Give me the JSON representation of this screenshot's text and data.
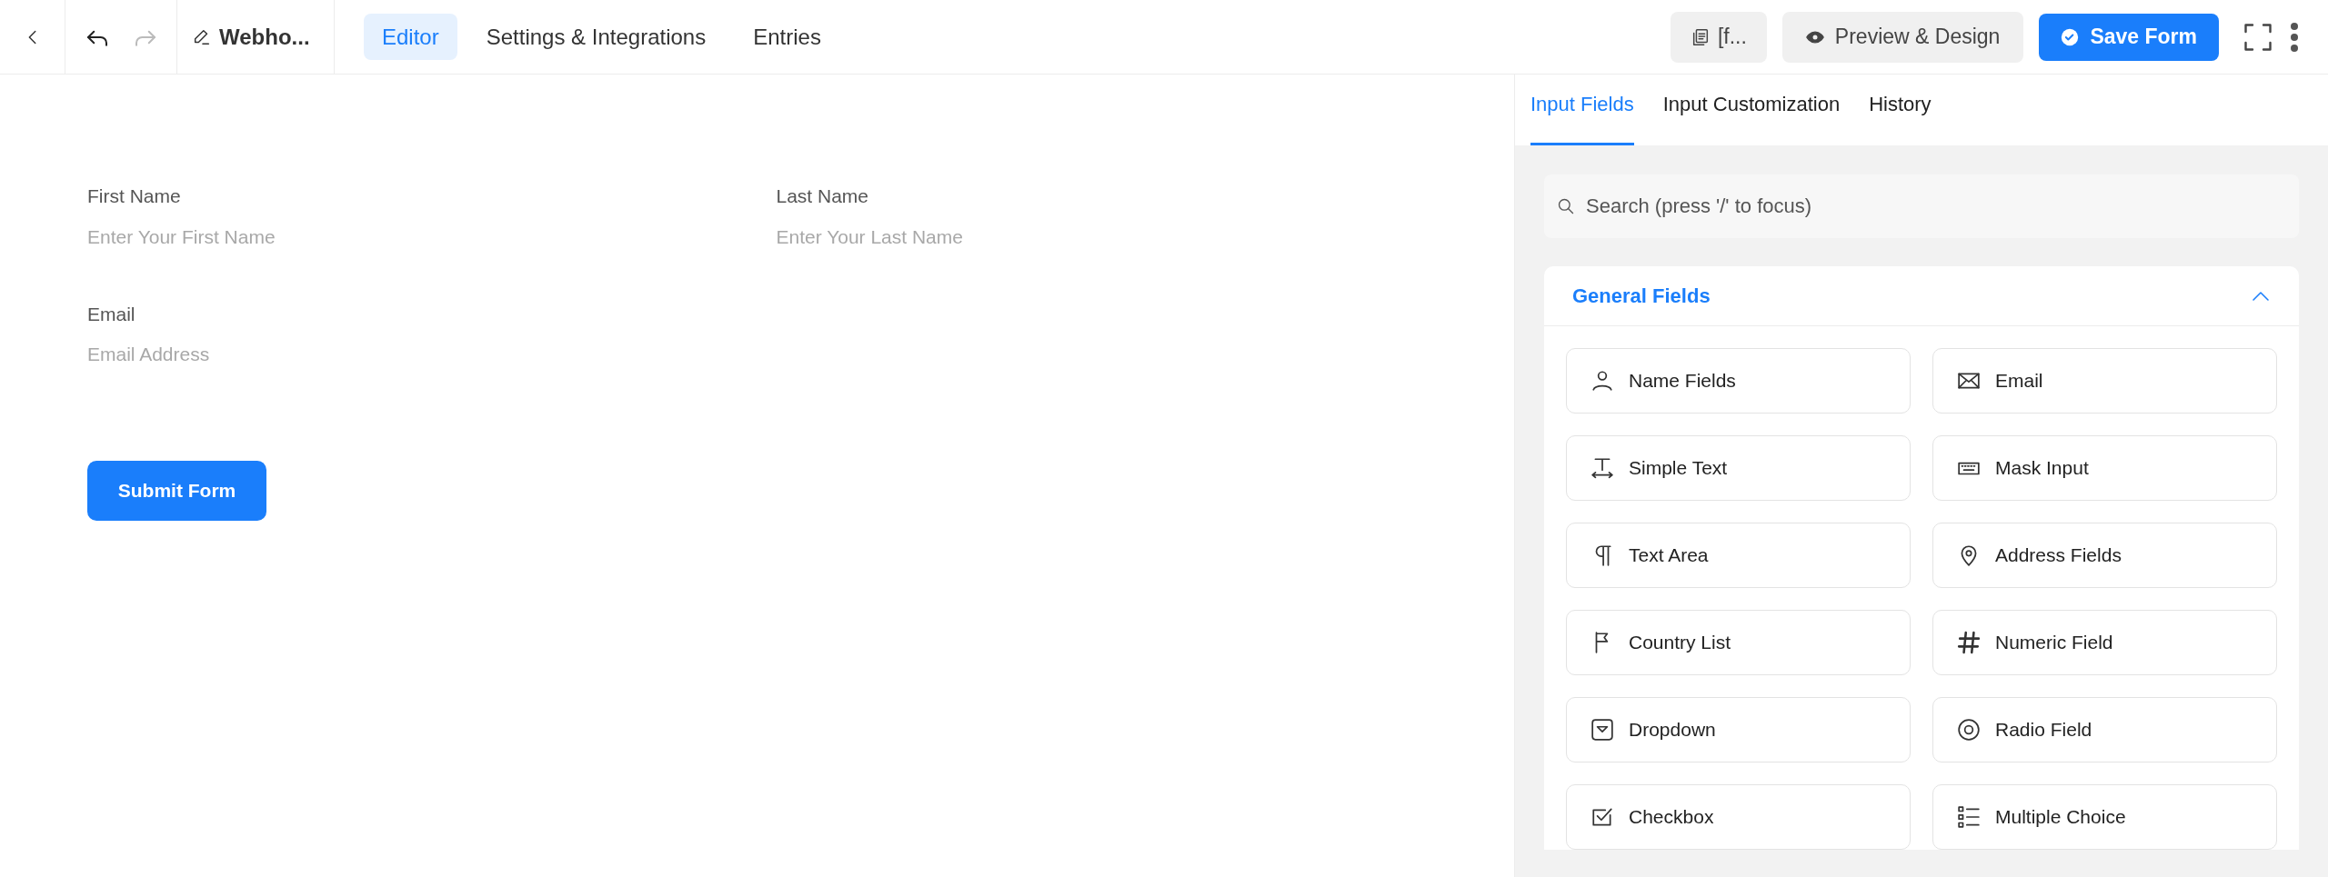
{
  "toolbar": {
    "history": [
      {
        "kind": "undo",
        "disabled": false
      },
      {
        "kind": "redo",
        "disabled": true
      }
    ],
    "title": "Webho...",
    "tabs": [
      {
        "label": "Editor",
        "selected": true
      },
      {
        "label": "Settings & Integrations",
        "selected": false
      },
      {
        "label": "Entries",
        "selected": false
      }
    ],
    "shortcode_button": "[f...",
    "preview_button": "Preview & Design",
    "save_button": "Save Form"
  },
  "form": {
    "rows": [
      [
        {
          "label": "First Name",
          "placeholder": "Enter Your First Name"
        },
        {
          "label": "Last Name",
          "placeholder": "Enter Your Last Name"
        }
      ],
      [
        {
          "label": "Email",
          "placeholder": "Email Address"
        }
      ]
    ],
    "submit_button": "Submit Form"
  },
  "panel": {
    "tabs": [
      {
        "label": "Input Fields",
        "selected": true
      },
      {
        "label": "Input Customization",
        "selected": false
      },
      {
        "label": "History",
        "selected": false
      }
    ],
    "search": {
      "placeholder": "Search (press '/' to focus)"
    },
    "section": {
      "title": "General Fields",
      "expanded": true,
      "items": [
        {
          "label": "Name Fields"
        },
        {
          "label": "Email"
        },
        {
          "label": "Simple Text"
        },
        {
          "label": "Mask Input"
        },
        {
          "label": "Text Area"
        },
        {
          "label": "Address Fields"
        },
        {
          "label": "Country List"
        },
        {
          "label": "Numeric Field"
        },
        {
          "label": "Dropdown"
        },
        {
          "label": "Radio Field"
        },
        {
          "label": "Checkbox"
        },
        {
          "label": "Multiple Choice"
        }
      ]
    }
  }
}
